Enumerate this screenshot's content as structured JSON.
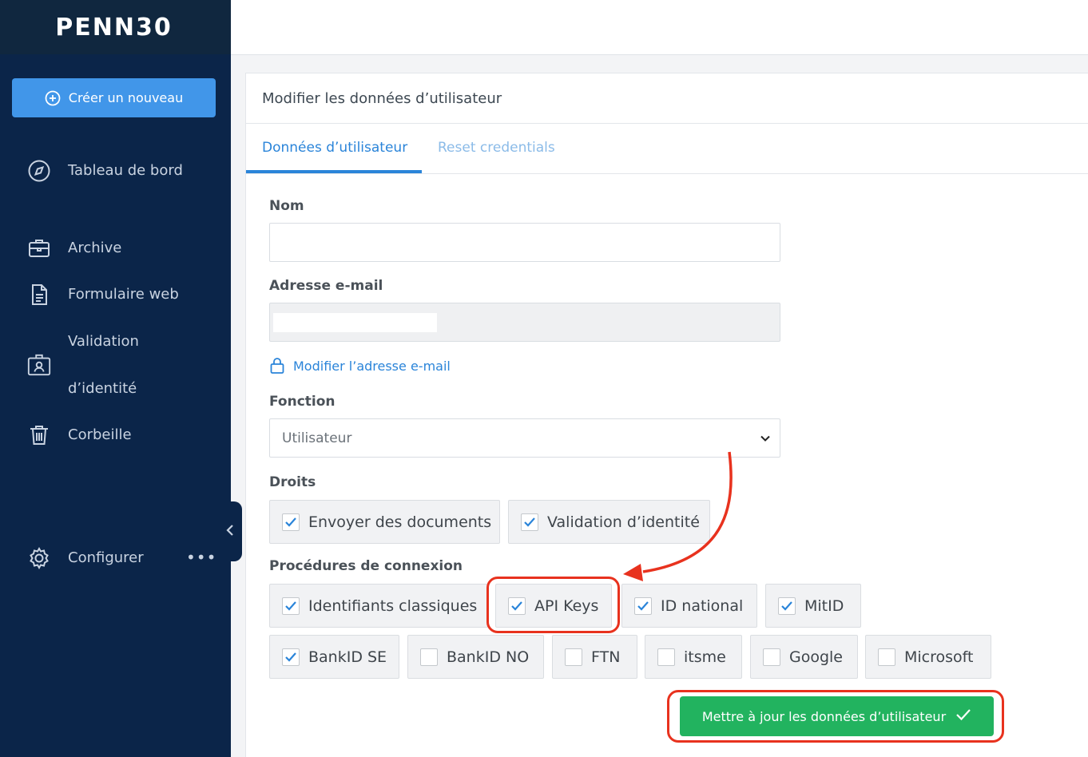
{
  "sidebar": {
    "logo": "PENN30",
    "create_button": "Créer un nouveau",
    "items": [
      {
        "label": "Tableau de bord",
        "icon": "compass-icon"
      },
      {
        "label": "Archive",
        "icon": "briefcase-icon"
      },
      {
        "label": "Formulaire web",
        "icon": "document-icon"
      },
      {
        "label": "Validation",
        "label2": "d’identité",
        "icon": "id-badge-icon"
      },
      {
        "label": "Corbeille",
        "icon": "trash-icon"
      },
      {
        "label": "Configurer",
        "icon": "gear-icon"
      }
    ],
    "more": "•••"
  },
  "card": {
    "title": "Modifier les données d’utilisateur",
    "tabs": [
      {
        "label": "Données d’utilisateur",
        "active": true
      },
      {
        "label": "Reset credentials",
        "active": false
      }
    ]
  },
  "form": {
    "name_label": "Nom",
    "name_value": "",
    "email_label": "Adresse e-mail",
    "email_value": "",
    "change_email_link": "Modifier l’adresse e-mail",
    "function_label": "Fonction",
    "function_value": "Utilisateur",
    "rights_label": "Droits",
    "rights": [
      {
        "label": "Envoyer des documents",
        "checked": true
      },
      {
        "label": "Validation d’identité",
        "checked": true
      }
    ],
    "login_label": "Procédures de connexion",
    "login_methods": [
      {
        "label": "Identifiants classiques",
        "checked": true
      },
      {
        "label": "API Keys",
        "checked": true
      },
      {
        "label": "ID national",
        "checked": true
      },
      {
        "label": "MitID",
        "checked": true
      },
      {
        "label": "BankID SE",
        "checked": true
      },
      {
        "label": "BankID NO",
        "checked": false
      },
      {
        "label": "FTN",
        "checked": false
      },
      {
        "label": "itsme",
        "checked": false
      },
      {
        "label": "Google",
        "checked": false
      },
      {
        "label": "Microsoft",
        "checked": false
      }
    ],
    "submit": "Mettre à jour les données d’utilisateur"
  },
  "colors": {
    "sidebar": "#0b2549",
    "primary": "#2a84d9",
    "create_button": "#4196e9",
    "submit": "#22b35f",
    "annotation": "#e8321e"
  }
}
